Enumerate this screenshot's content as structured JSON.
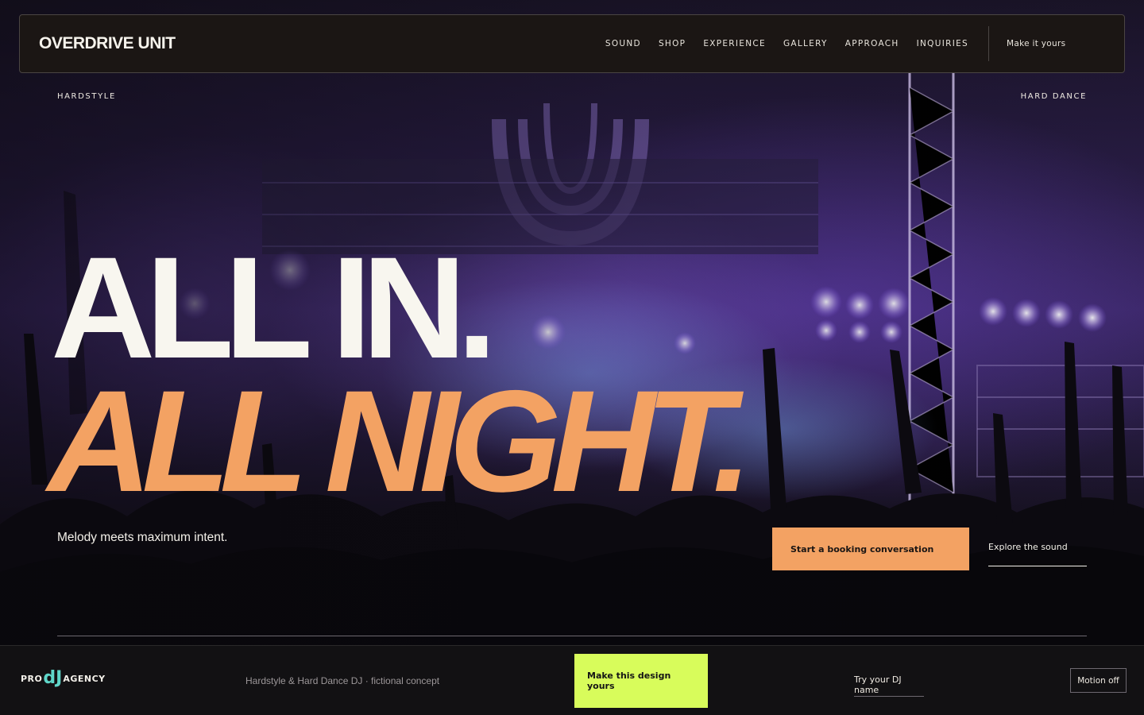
{
  "brand": "OVERDRIVE UNIT",
  "nav": {
    "items": [
      "SOUND",
      "SHOP",
      "EXPERIENCE",
      "GALLERY",
      "APPROACH",
      "INQUIRIES"
    ],
    "cta": "Make it yours"
  },
  "hero": {
    "tag_left": "HARDSTYLE",
    "tag_right": "HARD DANCE",
    "headline_line1": "ALL IN.",
    "headline_line2": "ALL NIGHT.",
    "tagline": "Melody meets maximum intent.",
    "primary_button": "Start a booking conversation",
    "secondary_link": "Explore the sound",
    "background_image": "concert-crowd-stage-photo"
  },
  "footer_bar": {
    "logo": {
      "pro": "PRO",
      "dj": "dJ",
      "agency": "AGENCY"
    },
    "caption": "Hardstyle & Hard Dance DJ · fictional concept",
    "design_button": "Make this design yours",
    "try_name_link": "Try your DJ name",
    "motion_button": "Motion off"
  },
  "colors": {
    "accent_orange": "#f3a263",
    "accent_lime": "#d8fc5b",
    "logo_teal": "#5fd6c9",
    "nav_bg": "#1b1614",
    "text_light": "#f8f6ef"
  }
}
